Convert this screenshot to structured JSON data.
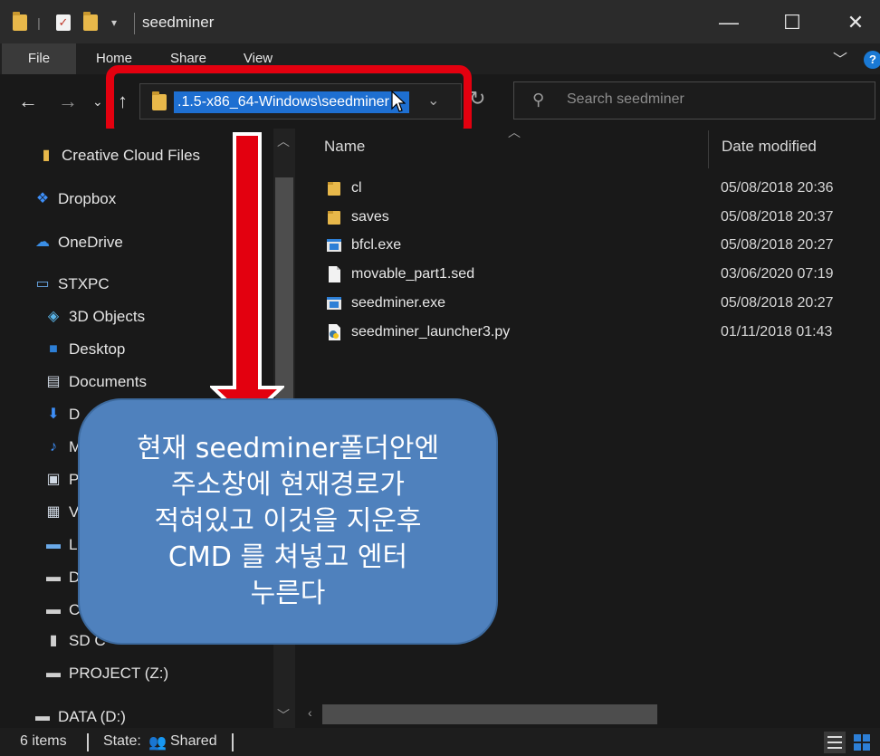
{
  "window": {
    "title": "seedminer",
    "minimize": "—",
    "maximize": "☐",
    "close": "✕"
  },
  "ribbon": {
    "tabs": [
      "File",
      "Home",
      "Share",
      "View"
    ]
  },
  "address_bar": {
    "path_text": ".1.5-x86_64-Windows\\seedminer"
  },
  "search": {
    "placeholder": "Search seedminer"
  },
  "nav_pane": {
    "items": [
      {
        "label": "Creative Cloud Files",
        "icon": "creative-cloud-icon"
      },
      {
        "label": "Dropbox",
        "icon": "dropbox-icon"
      },
      {
        "label": "OneDrive",
        "icon": "onedrive-icon"
      },
      {
        "label": "STXPC",
        "icon": "computer-icon"
      },
      {
        "label": "3D Objects",
        "icon": "3d-objects-icon"
      },
      {
        "label": "Desktop",
        "icon": "desktop-icon"
      },
      {
        "label": "Documents",
        "icon": "documents-icon"
      },
      {
        "label": "D",
        "icon": "downloads-icon"
      },
      {
        "label": "M",
        "icon": "music-icon"
      },
      {
        "label": "P",
        "icon": "pictures-icon"
      },
      {
        "label": "V",
        "icon": "videos-icon"
      },
      {
        "label": "L",
        "icon": "drive-icon"
      },
      {
        "label": "D",
        "icon": "drive-icon"
      },
      {
        "label": "C",
        "icon": "drive-icon"
      },
      {
        "label": "SD C",
        "icon": "sd-card-icon"
      },
      {
        "label": "PROJECT (Z:)",
        "icon": "network-drive-icon"
      },
      {
        "label": "DATA (D:)",
        "icon": "drive-icon"
      }
    ]
  },
  "file_list": {
    "columns": {
      "name": "Name",
      "date": "Date modified"
    },
    "rows": [
      {
        "name": "cl",
        "date": "05/08/2018 20:36",
        "icon": "folder-icon"
      },
      {
        "name": "saves",
        "date": "05/08/2018 20:37",
        "icon": "folder-icon"
      },
      {
        "name": "bfcl.exe",
        "date": "05/08/2018 20:27",
        "icon": "exe-icon"
      },
      {
        "name": "movable_part1.sed",
        "date": "03/06/2020 07:19",
        "icon": "file-icon"
      },
      {
        "name": "seedminer.exe",
        "date": "05/08/2018 20:27",
        "icon": "exe-icon"
      },
      {
        "name": "seedminer_launcher3.py",
        "date": "01/11/2018 01:43",
        "icon": "python-file-icon"
      }
    ]
  },
  "status_bar": {
    "items_count": "6 items",
    "state": "State:",
    "shared": "Shared"
  },
  "annotation": {
    "lines": [
      "현재 seedminer폴더안엔",
      "주소창에 현재경로가",
      "적혀있고 이것을 지운후",
      "CMD 를 쳐넣고 엔터",
      "누른다"
    ],
    "highlight_color": "#e3000f",
    "callout_color": "#4f81bd"
  },
  "colors": {
    "background": "#191919",
    "selection": "#1e6fd1",
    "folder": "#e8b84a"
  }
}
